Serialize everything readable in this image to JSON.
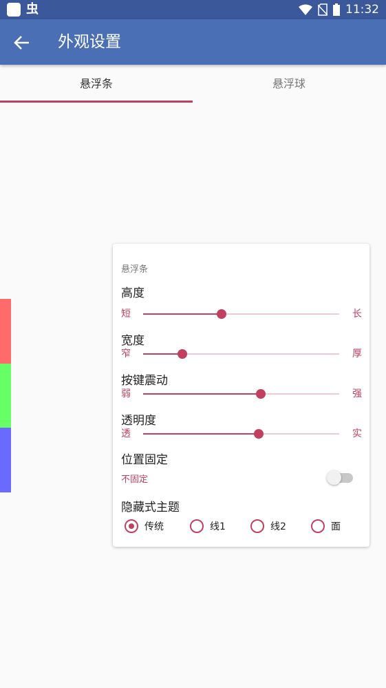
{
  "status_bar": {
    "app_glyph": "虫",
    "time": "11:32",
    "icons": [
      "wifi-icon",
      "no-sim-icon",
      "battery-icon"
    ]
  },
  "app_bar": {
    "title": "外观设置"
  },
  "tabs": [
    {
      "label": "悬浮条",
      "selected": true
    },
    {
      "label": "悬浮球",
      "selected": false
    }
  ],
  "side_strips": [
    "#ff6a6a",
    "#66ff66",
    "#6a6aff"
  ],
  "card": {
    "header": "悬浮条",
    "sliders": [
      {
        "label": "高度",
        "min_label": "短",
        "max_label": "长",
        "level": 0.4
      },
      {
        "label": "宽度",
        "min_label": "窄",
        "max_label": "厚",
        "level": 0.2
      },
      {
        "label": "按键震动",
        "min_label": "弱",
        "max_label": "强",
        "level": 0.6
      },
      {
        "label": "透明度",
        "min_label": "透",
        "max_label": "实",
        "level": 0.59
      }
    ],
    "toggle": {
      "label": "位置固定",
      "status": "不固定",
      "on": false
    },
    "theme": {
      "label": "隐藏式主题",
      "options": [
        "传统",
        "线1",
        "线2",
        "面"
      ],
      "selected_index": 0
    }
  },
  "colors": {
    "status_bar": "#3a589a",
    "app_bar": "#4a6fb5",
    "accent": "#c2405f",
    "track": "#f0c9d2"
  }
}
